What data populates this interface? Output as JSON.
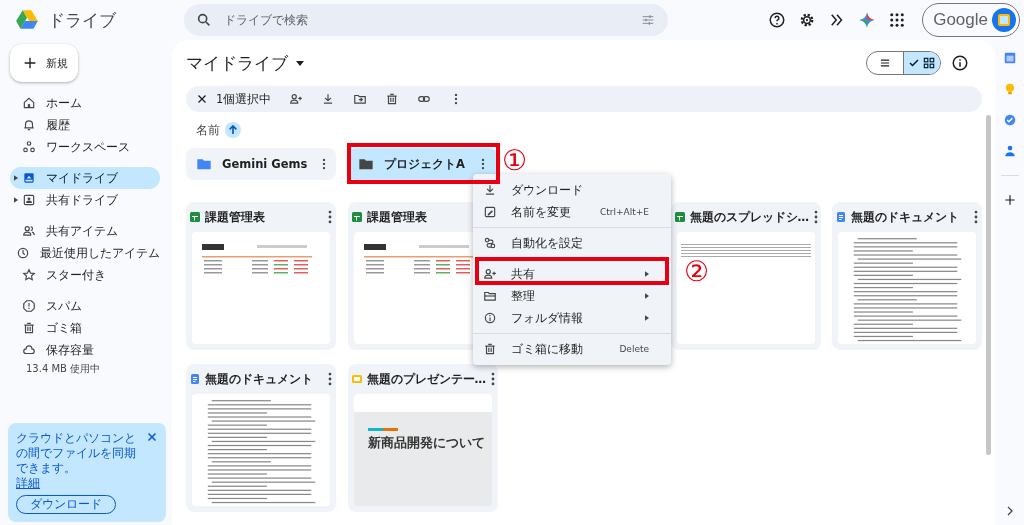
{
  "app": {
    "name": "ドライブ"
  },
  "search": {
    "placeholder": "ドライブで検索"
  },
  "account": {
    "label": "Google"
  },
  "new_button": {
    "label": "新規"
  },
  "nav_groups": [
    {
      "items": [
        {
          "kind": "home",
          "label": "ホーム",
          "selected": false,
          "expandable": false
        },
        {
          "kind": "activity",
          "label": "履歴",
          "selected": false,
          "expandable": false
        },
        {
          "kind": "workspace",
          "label": "ワークスペース",
          "selected": false,
          "expandable": false
        }
      ]
    },
    {
      "items": [
        {
          "kind": "drive",
          "label": "マイドライブ",
          "selected": true,
          "expandable": true
        },
        {
          "kind": "shared_drive",
          "label": "共有ドライブ",
          "selected": false,
          "expandable": true
        }
      ]
    },
    {
      "items": [
        {
          "kind": "shared",
          "label": "共有アイテム",
          "selected": false,
          "expandable": false
        },
        {
          "kind": "recent",
          "label": "最近使用したアイテム",
          "selected": false,
          "expandable": false
        },
        {
          "kind": "starred",
          "label": "スター付き",
          "selected": false,
          "expandable": false
        }
      ]
    },
    {
      "items": [
        {
          "kind": "spam",
          "label": "スパム",
          "selected": false,
          "expandable": false
        },
        {
          "kind": "trash",
          "label": "ゴミ箱",
          "selected": false,
          "expandable": false
        },
        {
          "kind": "storage",
          "label": "保存容量",
          "selected": false,
          "expandable": false
        }
      ]
    }
  ],
  "storage": {
    "usage": "13.4 MB 使用中"
  },
  "sync_banner": {
    "text": "クラウドとパソコンとの間でファイルを同期できます。",
    "link": "詳細",
    "button": "ダウンロード"
  },
  "page_title": "マイドライブ",
  "views": [
    {
      "kind": "list",
      "selected": false
    },
    {
      "kind": "grid",
      "selected": true
    }
  ],
  "selection_bar": {
    "count": "1個選択中"
  },
  "sort": {
    "label": "名前"
  },
  "folders": [
    {
      "name": "Gemini Gems",
      "selected": false,
      "color": "#4285f4"
    },
    {
      "name": "プロジェクトA",
      "selected": true,
      "color": "#444746"
    }
  ],
  "files": [
    {
      "kind": "sheet",
      "title": "課題管理表"
    },
    {
      "kind": "sheet",
      "title": "課題管理表"
    },
    {
      "kind": "sheet",
      "title": "無題のスプレッドシ…"
    },
    {
      "kind": "doc",
      "title": "無題のドキュメント"
    },
    {
      "kind": "doc",
      "title": "無題のドキュメント"
    },
    {
      "kind": "slides",
      "title": "無題のプレゼンテー…",
      "preview_title": "新商品開発について"
    }
  ],
  "context_menu": {
    "sections": [
      {
        "items": [
          {
            "kind": "download",
            "label": "ダウンロード",
            "submenu": false
          },
          {
            "kind": "rename",
            "label": "名前を変更",
            "shortcut": "Ctrl+Alt+E",
            "submenu": false
          }
        ]
      },
      {
        "items": [
          {
            "kind": "automation",
            "label": "自動化を設定",
            "submenu": false
          }
        ]
      },
      {
        "items": [
          {
            "kind": "share",
            "label": "共有",
            "submenu": true
          },
          {
            "kind": "organize",
            "label": "整理",
            "submenu": true
          },
          {
            "kind": "info",
            "label": "フォルダ情報",
            "submenu": true
          }
        ]
      },
      {
        "items": [
          {
            "kind": "trash",
            "label": "ゴミ箱に移動",
            "shortcut": "Delete",
            "submenu": false
          }
        ]
      }
    ]
  },
  "annotations": [
    {
      "kind": "folder",
      "mark": "①"
    },
    {
      "kind": "menu_item",
      "mark": "②"
    }
  ]
}
